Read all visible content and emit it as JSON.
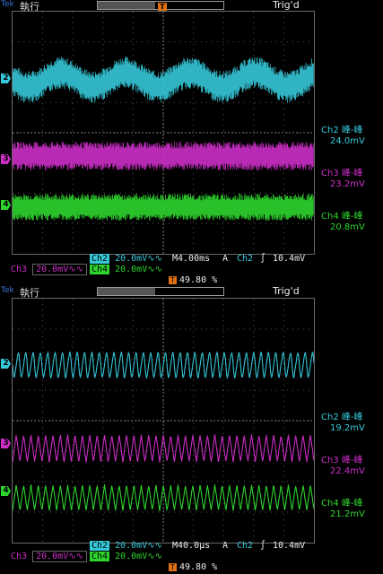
{
  "colors": {
    "ch2": "#35c8d8",
    "ch3": "#cc2fc8",
    "ch4": "#2fd52f",
    "trigger_marker": "#e07010",
    "tek_logo": "#3a6fd8",
    "grid": "#555555"
  },
  "panels": [
    {
      "header": {
        "logo": "Tek",
        "run_state": "執行",
        "trig_status": "Trig'd",
        "trigger_marker": "T"
      },
      "channel_markers": [
        "2",
        "3",
        "4"
      ],
      "measurements": [
        {
          "label": "Ch2 峰-峰",
          "value": "24.0mV"
        },
        {
          "label": "Ch3 峰-峰",
          "value": "23.2mV"
        },
        {
          "label": "Ch4 峰-峰",
          "value": "20.8mV"
        }
      ],
      "footer": {
        "ch2": "Ch2",
        "ch2_scale": "20.0mV∿∿",
        "timebase": "M4.00ms",
        "trigger_mode": "A",
        "trigger_source": "Ch2",
        "trigger_slope": "∫",
        "trigger_level": "10.4mV",
        "ch3": "Ch3",
        "ch3_scale": "20.0mV∿∿",
        "ch4": "Ch4",
        "ch4_scale": "20.0mV∿∿",
        "trigger_position": "49.80 %"
      }
    },
    {
      "header": {
        "logo": "Tek",
        "run_state": "執行",
        "trig_status": "Trig'd",
        "trigger_marker": "T"
      },
      "channel_markers": [
        "2",
        "3",
        "4"
      ],
      "measurements": [
        {
          "label": "Ch2 峰-峰",
          "value": "19.2mV"
        },
        {
          "label": "Ch3 峰-峰",
          "value": "22.4mV"
        },
        {
          "label": "Ch4 峰-峰",
          "value": "21.2mV"
        }
      ],
      "footer": {
        "ch2": "Ch2",
        "ch2_scale": "20.0mV∿∿",
        "timebase": "M40.0µs",
        "trigger_mode": "A",
        "trigger_source": "Ch2",
        "trigger_slope": "∫",
        "trigger_level": "10.4mV",
        "ch3": "Ch3",
        "ch3_scale": "20.0mV∿∿",
        "ch4": "Ch4",
        "ch4_scale": "20.0mV∿∿",
        "trigger_position": "49.80 %"
      }
    }
  ]
}
